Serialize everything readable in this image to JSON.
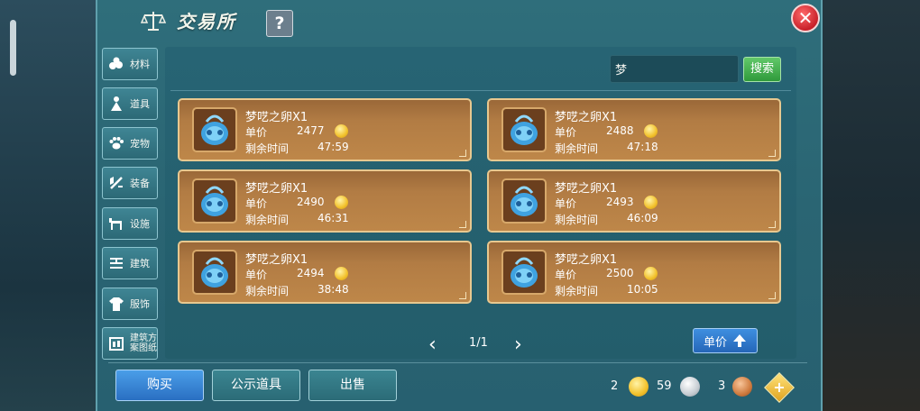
{
  "header": {
    "title": "交易所",
    "help_label": "?",
    "close_label": "✕"
  },
  "sidebar": {
    "items": [
      {
        "label": "材料",
        "icon": "materials-icon"
      },
      {
        "label": "道具",
        "icon": "props-icon"
      },
      {
        "label": "宠物",
        "icon": "paw-icon"
      },
      {
        "label": "装备",
        "icon": "equipment-icon"
      },
      {
        "label": "设施",
        "icon": "facility-icon"
      },
      {
        "label": "建筑",
        "icon": "building-icon"
      },
      {
        "label": "服饰",
        "icon": "clothing-icon"
      },
      {
        "label": "建筑方案图纸",
        "line1": "建筑方",
        "line2": "案图纸",
        "icon": "blueprint-icon"
      }
    ]
  },
  "search": {
    "value": "梦",
    "button_label": "搜索"
  },
  "listings": [
    {
      "name": "梦呓之卵X1",
      "price_label": "单价",
      "price": "2477",
      "time_label": "剩余时间",
      "time": "47:59"
    },
    {
      "name": "梦呓之卵X1",
      "price_label": "单价",
      "price": "2488",
      "time_label": "剩余时间",
      "time": "47:18"
    },
    {
      "name": "梦呓之卵X1",
      "price_label": "单价",
      "price": "2490",
      "time_label": "剩余时间",
      "time": "46:31"
    },
    {
      "name": "梦呓之卵X1",
      "price_label": "单价",
      "price": "2493",
      "time_label": "剩余时间",
      "time": "46:09"
    },
    {
      "name": "梦呓之卵X1",
      "price_label": "单价",
      "price": "2494",
      "time_label": "剩余时间",
      "time": "38:48"
    },
    {
      "name": "梦呓之卵X1",
      "price_label": "单价",
      "price": "2500",
      "time_label": "剩余时间",
      "time": "10:05"
    }
  ],
  "pagination": {
    "prev": "‹",
    "page": "1/1",
    "next": "›"
  },
  "sort": {
    "label": "单价"
  },
  "actions": {
    "buy": "购买",
    "public": "公示道具",
    "sell": "出售"
  },
  "currency": {
    "gold": "2",
    "silver": "59",
    "copper": "3",
    "add": "+"
  },
  "colors": {
    "panel": "#2f6e7b",
    "card": "#b27c44",
    "card_border": "#e8c88f",
    "buy_button": "#3a86d6",
    "search_button": "#3faa49",
    "close_button": "#d9333b"
  }
}
